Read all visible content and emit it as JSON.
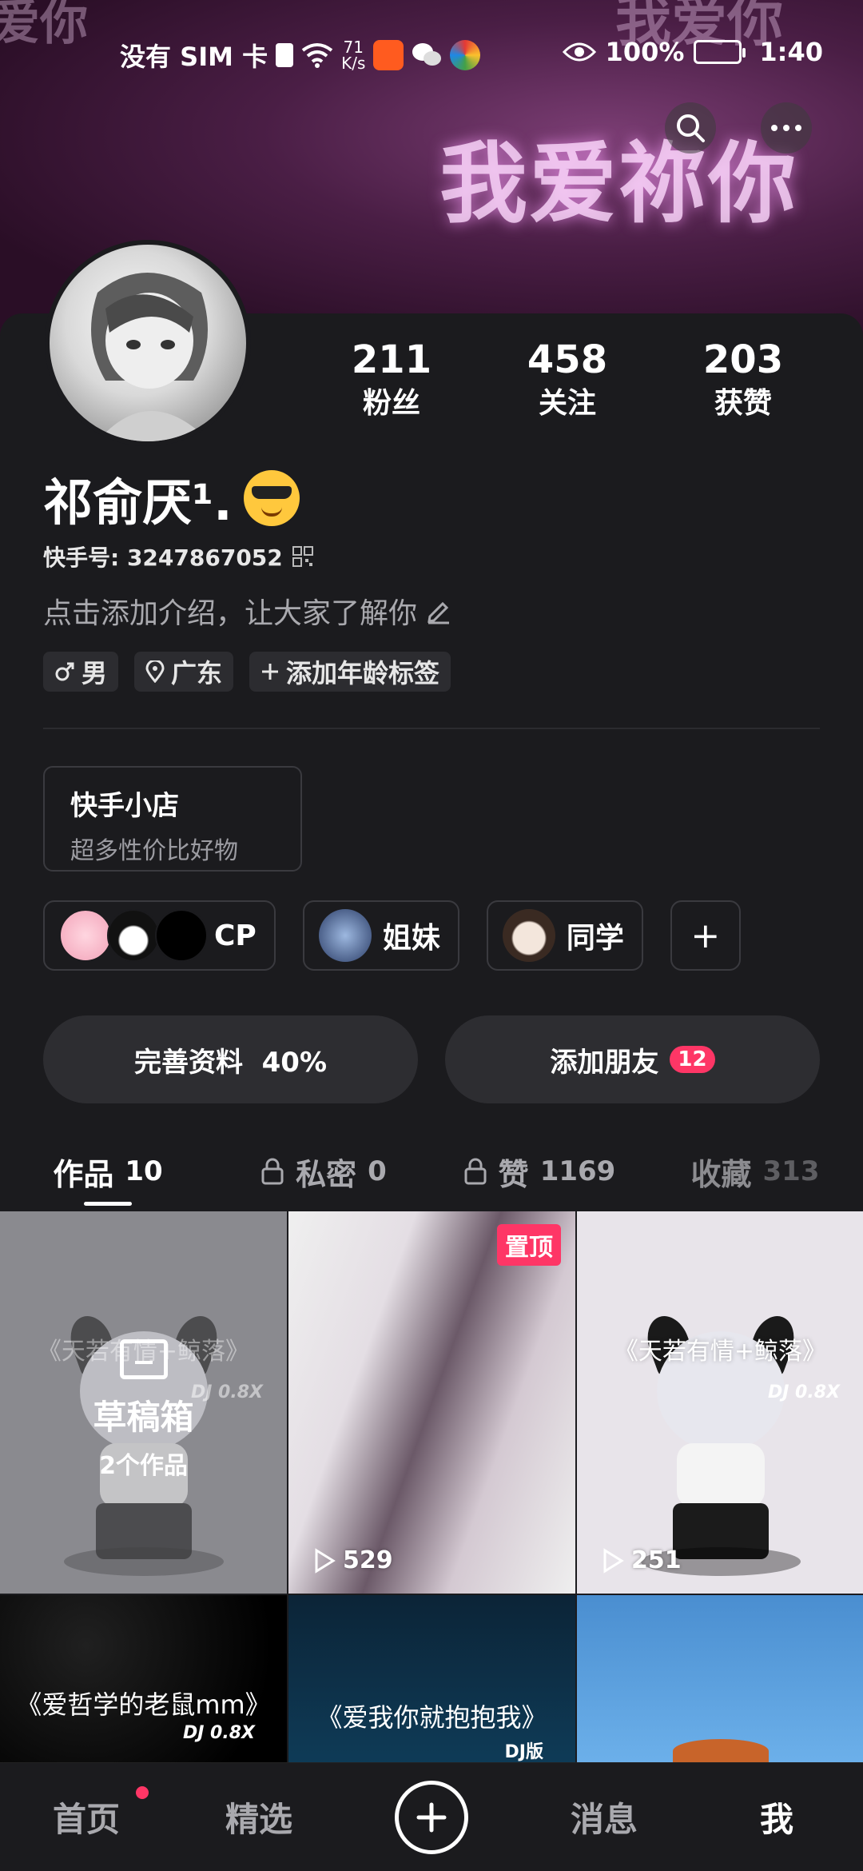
{
  "banner": {
    "main_text": "我爱祢你",
    "top_text": "我爱你",
    "top_left_text": "爱你"
  },
  "status_bar": {
    "carrier": "没有 SIM 卡",
    "net_speed_value": "71",
    "net_speed_unit": "K/s",
    "battery": "100%",
    "time": "1:40"
  },
  "profile": {
    "username": "祁俞厌¹.",
    "kuaishou_id": "快手号: 3247867052",
    "bio_placeholder": "点击添加介绍，让大家了解你",
    "tags": [
      {
        "icon": "male-icon",
        "label": "男"
      },
      {
        "icon": "location-icon",
        "label": "广东"
      },
      {
        "icon": "plus-icon",
        "label": "添加年龄标签"
      }
    ]
  },
  "stats": [
    {
      "value": "211",
      "label": "粉丝"
    },
    {
      "value": "458",
      "label": "关注"
    },
    {
      "value": "203",
      "label": "获赞"
    }
  ],
  "shop": {
    "title": "快手小店",
    "subtitle": "超多性价比好物"
  },
  "groups": [
    {
      "label": "CP"
    },
    {
      "label": "姐妹"
    },
    {
      "label": "同学"
    },
    {
      "label": "+"
    }
  ],
  "actions": {
    "complete_profile": "完善资料  40%",
    "add_friends": "添加朋友",
    "add_friends_badge": "12"
  },
  "tabs": [
    {
      "label": "作品",
      "count": "10"
    },
    {
      "label": "私密",
      "count": "0"
    },
    {
      "label": "赞",
      "count": "1169"
    },
    {
      "label": "收藏",
      "count": "313"
    }
  ],
  "grid": {
    "draft_title": "草稿箱",
    "draft_count": "2个作品",
    "cell1_caption": "《天若有情+鲸落》",
    "cell1_dj": "DJ 0.8X",
    "pinned_label": "置顶",
    "cell2_plays": "529",
    "cell3_caption": "《天若有情+鲸落》",
    "cell3_dj": "DJ 0.8X",
    "cell3_plays": "251",
    "cell4_caption": "《爱哲学的老鼠mm》",
    "cell4_dj": "DJ 0.8X",
    "cell5_caption": "《爱我你就抱抱我》",
    "cell5_dj": "DJ版"
  },
  "navbar": {
    "home": "首页",
    "featured": "精选",
    "messages": "消息",
    "me": "我"
  }
}
